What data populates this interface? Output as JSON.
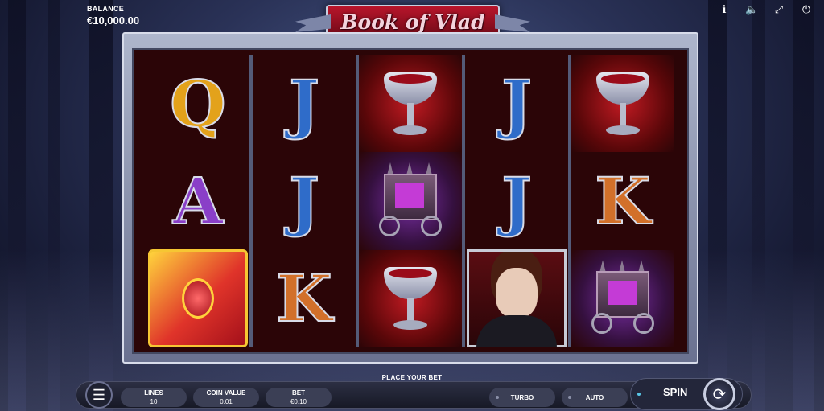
{
  "balance": {
    "label": "BALANCE",
    "value": "€10,000.00"
  },
  "top_icons": [
    "info-icon",
    "sound-icon",
    "fullscreen-icon",
    "power-icon"
  ],
  "logo": {
    "text": "Book of Vlad"
  },
  "reels": [
    [
      "Q",
      "A",
      "book"
    ],
    [
      "J",
      "J",
      "K"
    ],
    [
      "goblet",
      "carriage",
      "goblet"
    ],
    [
      "J",
      "J",
      "vampire"
    ],
    [
      "goblet",
      "K",
      "carriage"
    ]
  ],
  "status": {
    "message": "PLACE YOUR BET"
  },
  "controls": {
    "lines": {
      "label": "LINES",
      "value": "10"
    },
    "coin_value": {
      "label": "COIN VALUE",
      "value": "0.01"
    },
    "bet": {
      "label": "BET",
      "value": "€0.10"
    },
    "turbo_label": "TURBO",
    "auto_label": "AUTO",
    "spin_label": "SPIN"
  },
  "colors": {
    "reel_background": "#2b0507",
    "logo_red": "#b8152b",
    "accent_spin": "#58c5e6"
  }
}
